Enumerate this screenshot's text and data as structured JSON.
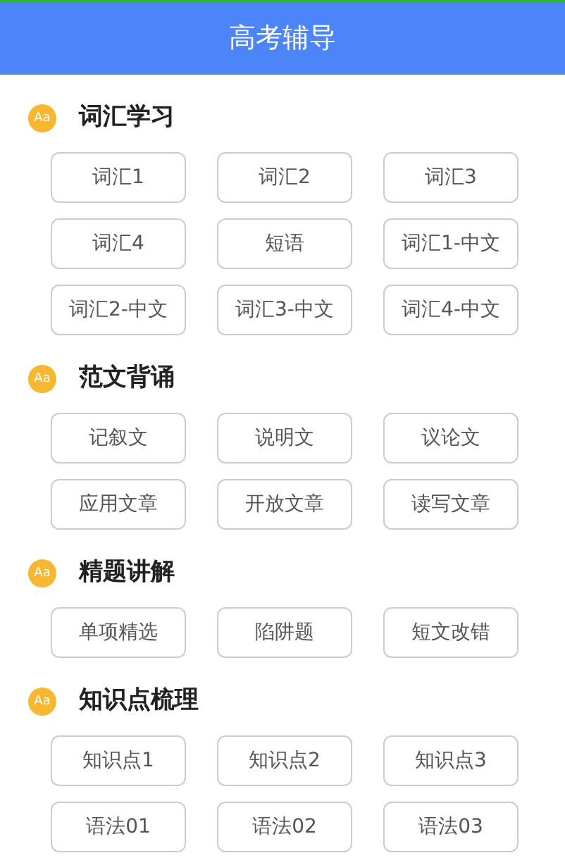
{
  "title": "高考辅导",
  "sections": [
    {
      "badge": "Aa",
      "title": "词汇学习",
      "items": [
        "词汇1",
        "词汇2",
        "词汇3",
        "词汇4",
        "短语",
        "词汇1-中文",
        "词汇2-中文",
        "词汇3-中文",
        "词汇4-中文"
      ]
    },
    {
      "badge": "Aa",
      "title": "范文背诵",
      "items": [
        "记叙文",
        "说明文",
        "议论文",
        "应用文章",
        "开放文章",
        "读写文章"
      ]
    },
    {
      "badge": "Aa",
      "title": "精题讲解",
      "items": [
        "单项精选",
        "陷阱题",
        "短文改错"
      ]
    },
    {
      "badge": "Aa",
      "title": "知识点梳理",
      "items": [
        "知识点1",
        "知识点2",
        "知识点3",
        "语法01",
        "语法02",
        "语法03"
      ]
    }
  ]
}
